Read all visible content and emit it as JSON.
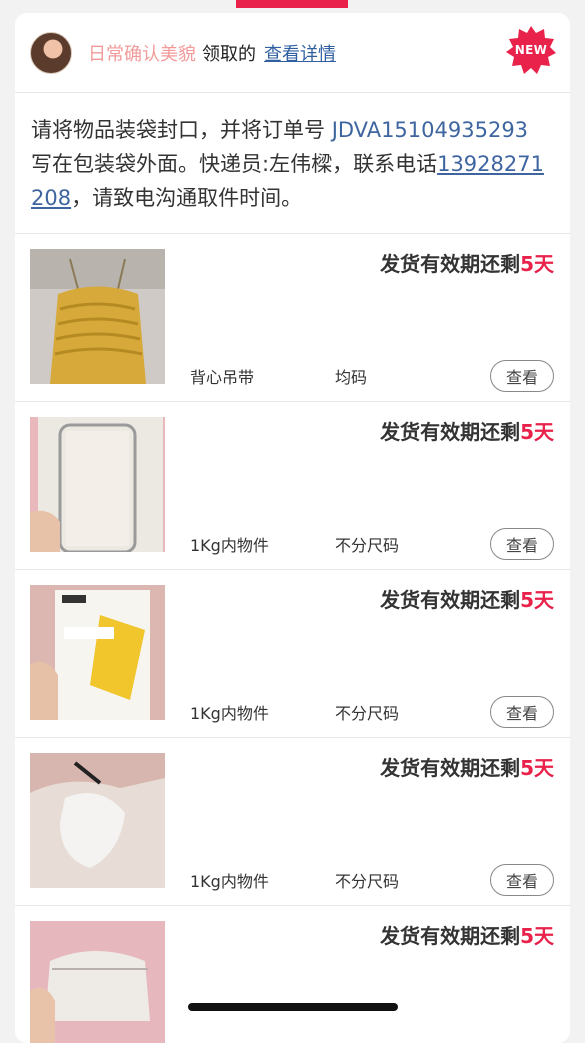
{
  "header": {
    "username": "日常确认美貌",
    "received_label": "领取的",
    "view_detail_label": "查看详情",
    "new_badge": "NEW"
  },
  "notice": {
    "text_before_order": "请将物品装袋封口，并将订单号 ",
    "order_number": "JDVA15104935293",
    "text_after_order": " 写在包装袋外面。快递员:左伟樑，联系电话",
    "phone": "13928271208",
    "text_end": "，请致电沟通取件时间。"
  },
  "validity_label": "发货有效期还剩",
  "items": [
    {
      "thumb": "yellow-ruffle-camisole",
      "days": "5天",
      "attr1": "背心吊带",
      "attr2": "均码",
      "button": "查看"
    },
    {
      "thumb": "phone-case-box",
      "days": "5天",
      "attr1": "1Kg内物件",
      "attr2": "不分尺码",
      "button": "查看"
    },
    {
      "thumb": "tempered-glass-package",
      "days": "5天",
      "attr1": "1Kg内物件",
      "attr2": "不分尺码",
      "button": "查看"
    },
    {
      "thumb": "white-tissue-product",
      "days": "5天",
      "attr1": "1Kg内物件",
      "attr2": "不分尺码",
      "button": "查看"
    },
    {
      "thumb": "white-pouch-bag",
      "days": "5天"
    }
  ],
  "colors": {
    "accent": "#e8224b",
    "link": "#3e65a0",
    "username": "#f29a9a"
  }
}
